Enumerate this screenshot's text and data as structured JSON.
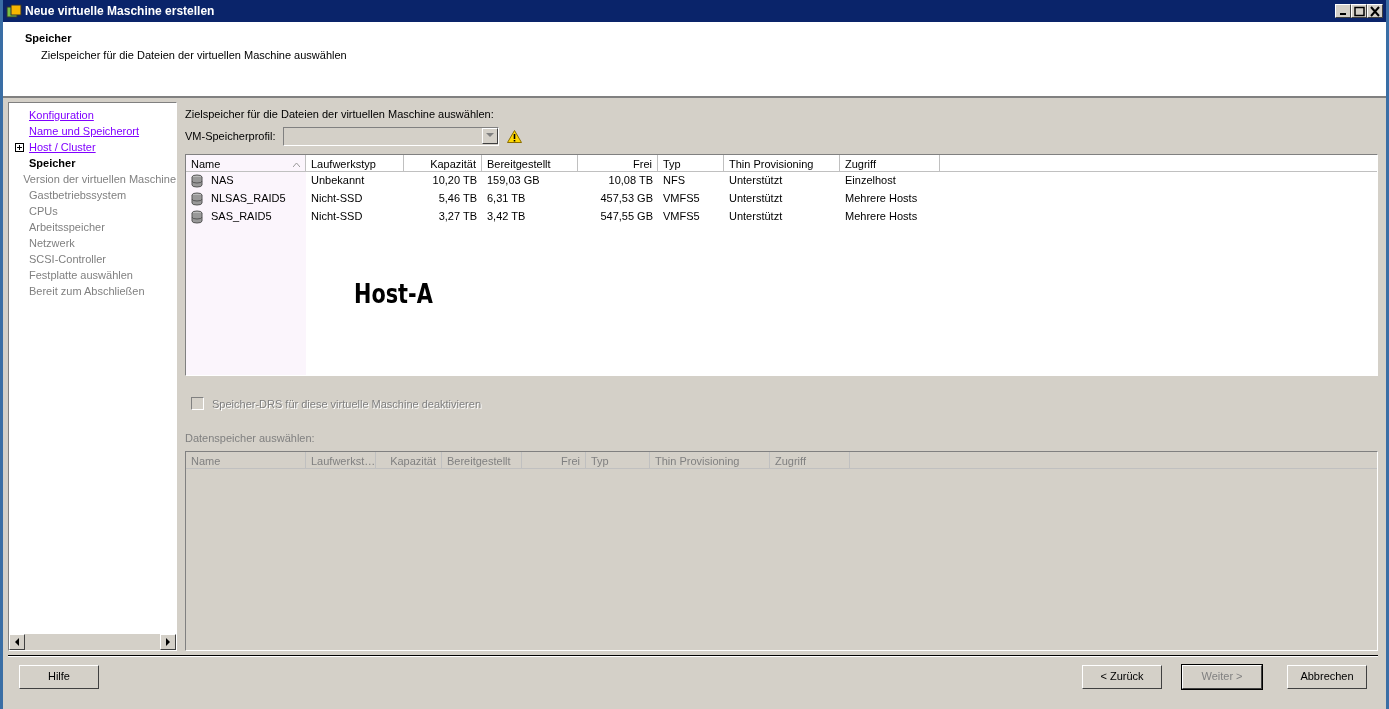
{
  "window": {
    "title": "Neue virtuelle Maschine erstellen"
  },
  "header": {
    "title": "Speicher",
    "subtitle": "Zielspeicher für die Dateien der virtuellen Maschine auswählen"
  },
  "sidebar": {
    "items": [
      {
        "label": "Konfiguration",
        "kind": "link",
        "expandable": false
      },
      {
        "label": "Name und Speicherort",
        "kind": "link",
        "expandable": false
      },
      {
        "label": "Host / Cluster",
        "kind": "link",
        "expandable": true
      },
      {
        "label": "Speicher",
        "kind": "current",
        "expandable": false
      },
      {
        "label": "Version der virtuellen Maschine",
        "kind": "pending",
        "expandable": false
      },
      {
        "label": "Gastbetriebssystem",
        "kind": "pending",
        "expandable": false
      },
      {
        "label": "CPUs",
        "kind": "pending",
        "expandable": false
      },
      {
        "label": "Arbeitsspeicher",
        "kind": "pending",
        "expandable": false
      },
      {
        "label": "Netzwerk",
        "kind": "pending",
        "expandable": false
      },
      {
        "label": "SCSI-Controller",
        "kind": "pending",
        "expandable": false
      },
      {
        "label": "Festplatte auswählen",
        "kind": "pending",
        "expandable": false
      },
      {
        "label": "Bereit zum Abschließen",
        "kind": "pending",
        "expandable": false
      }
    ]
  },
  "content": {
    "instruction": "Zielspeicher für die Dateien der virtuellen Maschine auswählen:",
    "profile": {
      "label": "VM-Speicherprofil:",
      "disabled": true,
      "warning": true
    },
    "table": {
      "columns": [
        "Name",
        "Laufwerkstyp",
        "Kapazität",
        "Bereitgestellt",
        "Frei",
        "Typ",
        "Thin Provisioning",
        "Zugriff"
      ],
      "rows": [
        [
          "NAS",
          "Unbekannt",
          "10,20 TB",
          "159,03 GB",
          "10,08 TB",
          "NFS",
          "Unterstützt",
          "Einzelhost"
        ],
        [
          "NLSAS_RAID5",
          "Nicht-SSD",
          "5,46 TB",
          "6,31 TB",
          "457,53 GB",
          "VMFS5",
          "Unterstützt",
          "Mehrere Hosts"
        ],
        [
          "SAS_RAID5",
          "Nicht-SSD",
          "3,27 TB",
          "3,42 TB",
          "547,55 GB",
          "VMFS5",
          "Unterstützt",
          "Mehrere Hosts"
        ]
      ],
      "overlay_label": "Host-A"
    },
    "drs_checkbox": {
      "label": "Speicher-DRS für diese virtuelle Maschine deaktivieren",
      "checked": false,
      "disabled": true
    },
    "datastore_label": "Datenspeicher auswählen:",
    "datastore_table": {
      "columns": [
        "Name",
        "Laufwerkst…",
        "Kapazität",
        "Bereitgestellt",
        "Frei",
        "Typ",
        "Thin Provisioning",
        "Zugriff"
      ]
    }
  },
  "buttons": [
    {
      "label": "Hilfe",
      "kind": "help",
      "disabled": false
    },
    {
      "label": "< Zurück",
      "kind": "nav",
      "disabled": false
    },
    {
      "label": "Weiter >",
      "kind": "nav",
      "disabled": true
    },
    {
      "label": "Abbrechen",
      "kind": "nav",
      "disabled": false
    }
  ]
}
